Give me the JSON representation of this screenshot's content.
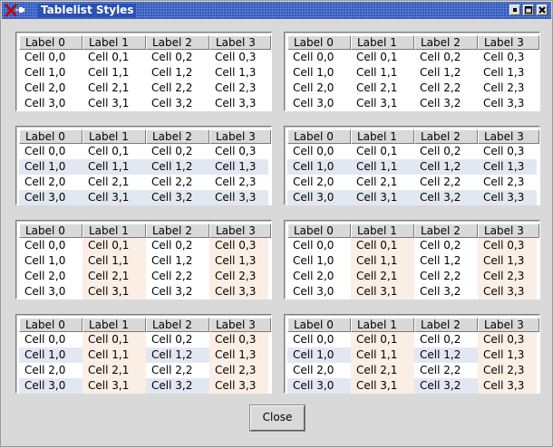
{
  "window": {
    "title": "Tablelist Styles"
  },
  "titlebar_buttons": [
    "minimize-icon",
    "maximize-icon",
    "close-icon"
  ],
  "colors": {
    "stripe": "#e2e8f2",
    "column": "#fbeee4",
    "header": "#d9d9d9",
    "titlebar": "#2a50b4"
  },
  "columns": [
    "Label 0",
    "Label 1",
    "Label 2",
    "Label 3"
  ],
  "rows": [
    [
      "Cell 0,0",
      "Cell 0,1",
      "Cell 0,2",
      "Cell 0,3"
    ],
    [
      "Cell 1,0",
      "Cell 1,1",
      "Cell 1,2",
      "Cell 1,3"
    ],
    [
      "Cell 2,0",
      "Cell 2,1",
      "Cell 2,2",
      "Cell 2,3"
    ],
    [
      "Cell 3,0",
      "Cell 3,1",
      "Cell 3,2",
      "Cell 3,3"
    ]
  ],
  "tables": [
    {
      "striped_rows": false,
      "highlighted_columns": []
    },
    {
      "striped_rows": false,
      "highlighted_columns": []
    },
    {
      "striped_rows": true,
      "highlighted_columns": []
    },
    {
      "striped_rows": true,
      "highlighted_columns": []
    },
    {
      "striped_rows": false,
      "highlighted_columns": [
        1,
        3
      ]
    },
    {
      "striped_rows": false,
      "highlighted_columns": [
        1,
        3
      ]
    },
    {
      "striped_rows": true,
      "highlighted_columns": [
        1,
        3
      ]
    },
    {
      "striped_rows": true,
      "highlighted_columns": [
        1,
        3
      ]
    }
  ],
  "close_button": {
    "label": "Close"
  }
}
